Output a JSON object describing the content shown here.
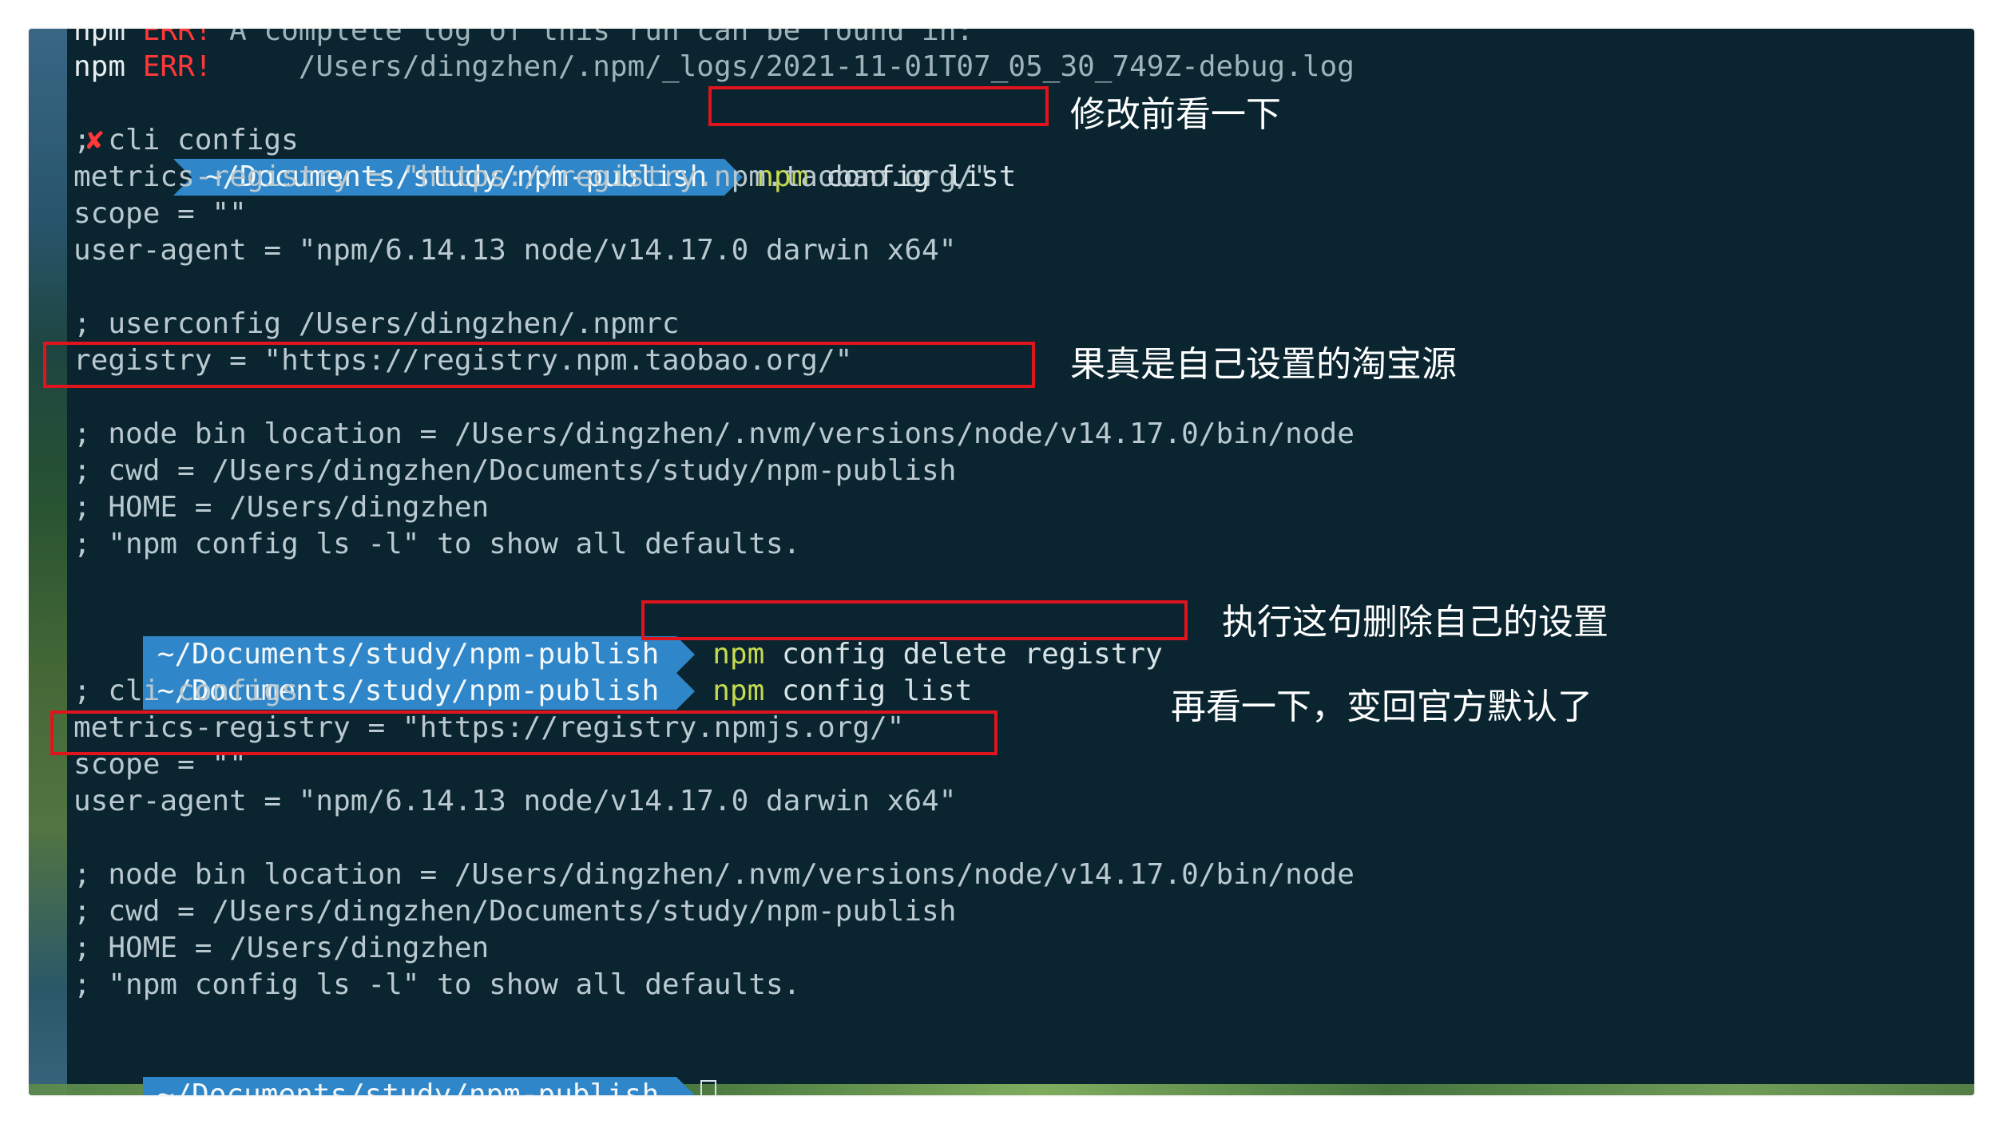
{
  "terminal": {
    "lines": [
      {
        "a": "npm",
        "b": "ERR!",
        "c": " A complete log of this run can be found in:"
      },
      {
        "a": "npm",
        "b": "ERR!",
        "c": "     /Users/dingzhen/.npm/_logs/2021-11-01T07_05_30_749Z-debug.log"
      }
    ],
    "prompt1": {
      "x": "✘",
      "path": "~/Documents/study/npm-publish",
      "npm": "npm",
      "cmd": " config list"
    },
    "block1": [
      "; cli configs",
      "metrics-registry = \"https://registry.npm.taobao.org/\"",
      "scope = \"\"",
      "user-agent = \"npm/6.14.13 node/v14.17.0 darwin x64\"",
      "",
      "; userconfig /Users/dingzhen/.npmrc",
      "registry = \"https://registry.npm.taobao.org/\"",
      "",
      "; node bin location = /Users/dingzhen/.nvm/versions/node/v14.17.0/bin/node",
      "; cwd = /Users/dingzhen/Documents/study/npm-publish",
      "; HOME = /Users/dingzhen",
      "; \"npm config ls -l\" to show all defaults."
    ],
    "prompt2": {
      "path": "~/Documents/study/npm-publish",
      "npm": "npm",
      "cmd": " config delete registry"
    },
    "prompt3": {
      "path": "~/Documents/study/npm-publish",
      "npm": "npm",
      "cmd": " config list"
    },
    "block2": [
      "; cli configs",
      "metrics-registry = \"https://registry.npmjs.org/\"",
      "scope = \"\"",
      "user-agent = \"npm/6.14.13 node/v14.17.0 darwin x64\"",
      "",
      "; node bin location = /Users/dingzhen/.nvm/versions/node/v14.17.0/bin/node",
      "; cwd = /Users/dingzhen/Documents/study/npm-publish",
      "; HOME = /Users/dingzhen",
      "; \"npm config ls -l\" to show all defaults."
    ],
    "prompt4": {
      "path": "~/Documents/study/npm-publish"
    }
  },
  "annotations": {
    "a1": "修改前看一下",
    "a2": "果真是自己设置的淘宝源",
    "a3": "执行这句删除自己的设置",
    "a4": "再看一下，变回官方默认了"
  },
  "colors": {
    "background": "#0a2530",
    "prompt_bg": "#2f86c8",
    "highlight": "#e0141c",
    "err": "#ff3838",
    "npm_keyword": "#c7d94e"
  }
}
